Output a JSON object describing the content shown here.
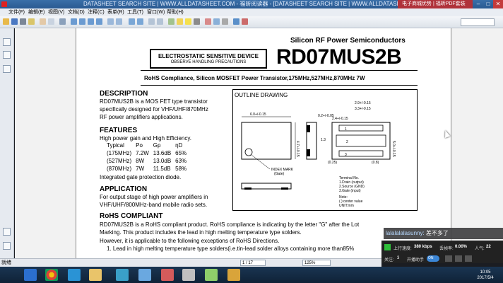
{
  "window": {
    "title": "DATASHEET SEARCH SITE | WWW.ALLDATASHEET.COM - 福昕阅读器 - [DATASHEET SEARCH SITE | WWW.ALLDATASHEET.COM]",
    "ad_text": "电子商城优势 | 福昕PDF套装"
  },
  "menu": [
    "文件(F)",
    "编辑(E)",
    "视图(V)",
    "文档(D)",
    "注释(C)",
    "表单(R)",
    "工具(T)",
    "窗口(W)",
    "帮助(H)"
  ],
  "toolbar": {
    "search_placeholder": ""
  },
  "document": {
    "header_sub": "Silicon RF Power Semiconductors",
    "esd_line1": "ELECTROSTATIC SENSITIVE DEVICE",
    "esd_line2": "OBSERVE HANDLING PRECAUTIONS",
    "part_number": "RD07MUS2B",
    "subtitle": "RoHS  Compliance,  Silicon  MOSFET  Power  Transistor,175MHz,527MHz,870MHz     7W",
    "description": {
      "heading": "DESCRIPTION",
      "lines": [
        "RD07MUS2B is a MOS FET type transistor",
        "specifically designed for VHF/UHF/870MHz",
        "RF power amplifiers applications."
      ]
    },
    "features": {
      "heading": "FEATURES",
      "intro": "High power gain and High Efficiency.",
      "table_header": [
        "Typical",
        "Po",
        "Gp",
        "ηD"
      ],
      "rows": [
        [
          "(175MHz)",
          "7.2W",
          "13.6dB",
          "65%"
        ],
        [
          "(527MHz)",
          "8W",
          "13.0dB",
          "63%"
        ],
        [
          "(870MHz)",
          "7W",
          "11.5dB",
          "58%"
        ]
      ],
      "extra": "Integrated gate protection diode."
    },
    "application": {
      "heading": "APPLICATION",
      "lines": [
        "For output stage of high power amplifiers in",
        "VHF/UHF/800MHz-band mobile radio sets."
      ]
    },
    "rohs": {
      "heading": "RoHS COMPLIANT",
      "lines": [
        "RD07MUS2B is a RoHS compliant product.      RoHS compliance is indicating by the letter \"G\" after the Lot",
        "Marking. This product includes the lead in high melting temperature type solders.",
        "However, it is applicable to the following exceptions of RoHS Directions.",
        "1.    Lead in high melting temperature type solders(i.e.tin-lead solder alloys containing more than85%"
      ]
    },
    "outline": {
      "title": "OUTLINE DRAWING",
      "index_mark": "INDEX MARK",
      "index_mark_sub": "(Gate)",
      "terminals": [
        "Terminal No.",
        "1.Drain (output)",
        "2.Source (GND)",
        "3.Gate (input)"
      ],
      "note": [
        "Note:",
        "( ):center value",
        "UNIT:mm"
      ],
      "dims": {
        "d1": "6.0+/-0.15",
        "d2": "0.2+/-0.05",
        "d3": "2.4+/-0.15",
        "d4": "2.9+/-0.15",
        "d5": "3.3+/-0.15",
        "d6": "4.7+/-0.15",
        "d7": "5.0+/-0.15",
        "d8": "1.3",
        "d9": "(0.25)",
        "d10": "(0.8)",
        "d11": "1",
        "d12": "2",
        "d13": "3"
      }
    }
  },
  "chat": {
    "user": "lalalalalasunny:",
    "message": "差不多了"
  },
  "stream": {
    "upload_label": "上行速度:",
    "upload_value": "380 kbps",
    "loss_label": "丢帧率:",
    "loss_value": "0.00%",
    "viewers_label": "人气:",
    "viewers_value": "22",
    "follow_label": "关注:",
    "follow_value": "3",
    "assist_label": "开播助手",
    "toggle": "ON"
  },
  "status": {
    "label": "就绪",
    "page": "1 / 17",
    "zoom": "125%"
  },
  "clock": {
    "time": "10:05",
    "date": "2017/5/4"
  }
}
